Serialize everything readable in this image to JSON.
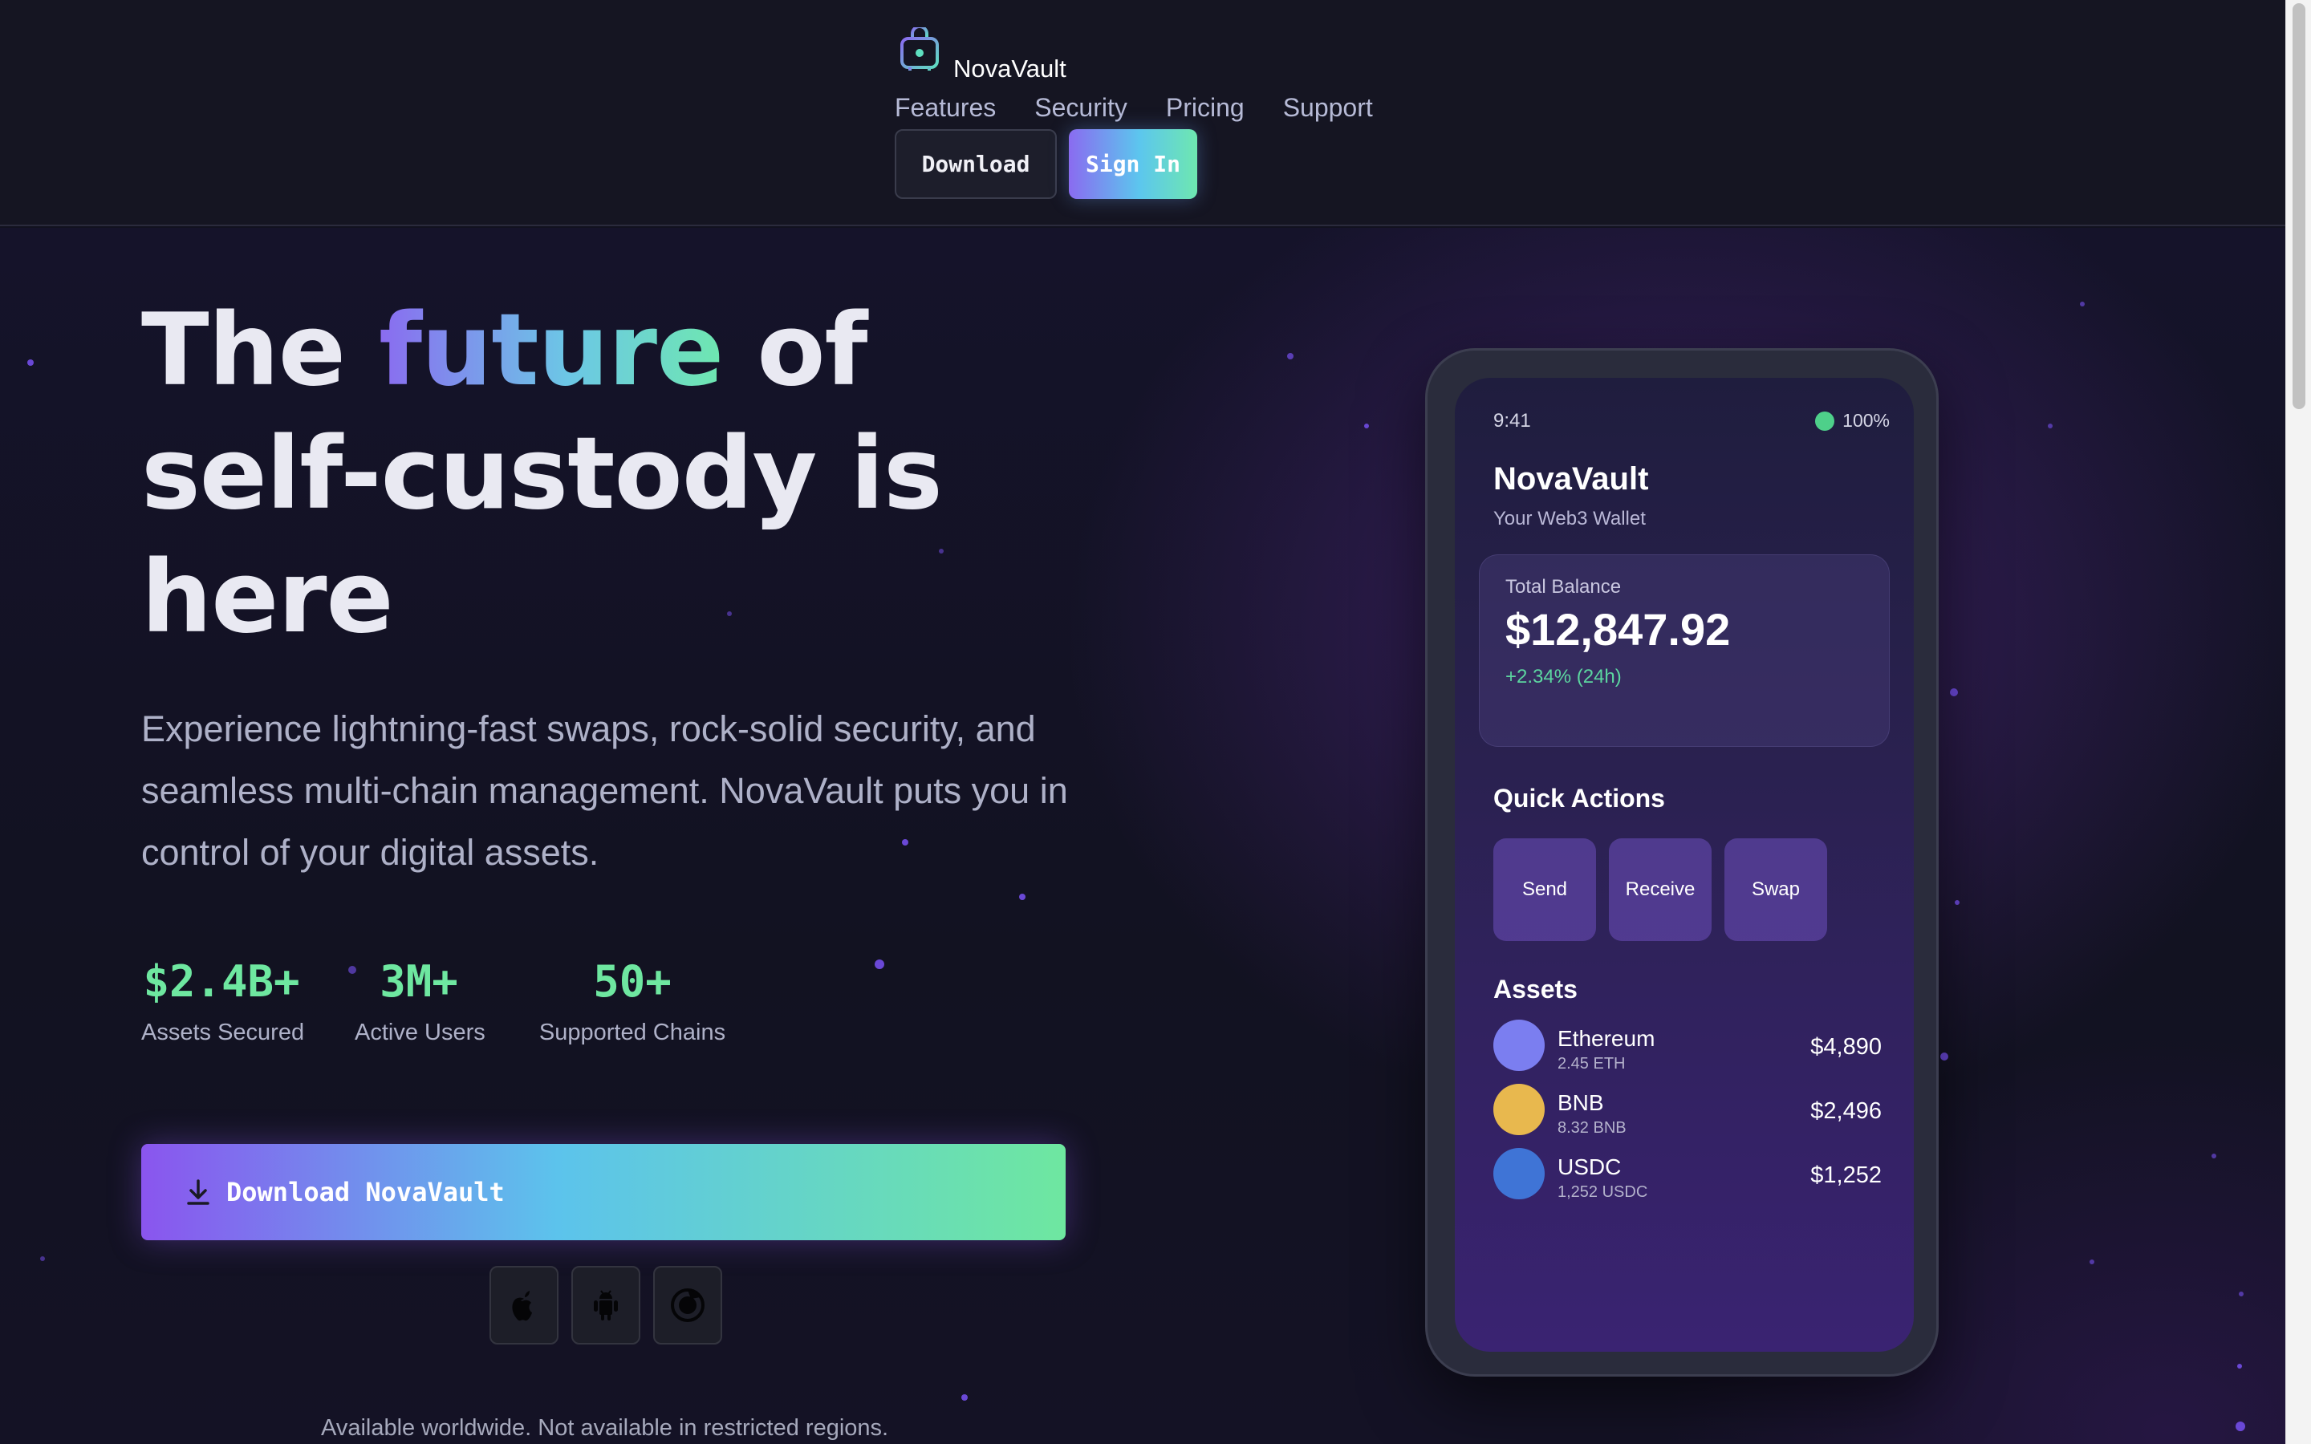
{
  "header": {
    "brand": "NovaVault",
    "nav": [
      "Features",
      "Security",
      "Pricing",
      "Support"
    ],
    "download_label": "Download",
    "signin_label": "Sign In"
  },
  "hero": {
    "headline_pre": "The ",
    "headline_accent": "future",
    "headline_post": " of self-custody is here",
    "subtext": "Experience lightning-fast swaps, rock-solid security, and seamless multi-chain management. NovaVault puts you in control of your digital assets.",
    "stats": [
      {
        "value": "$2.4B+",
        "label": "Assets Secured"
      },
      {
        "value": "3M+",
        "label": "Active Users"
      },
      {
        "value": "50+",
        "label": "Supported Chains"
      }
    ],
    "cta_label": "Download NovaVault",
    "platform_icons": [
      "apple-icon",
      "android-icon",
      "web-icon"
    ],
    "availability": "Available worldwide. Not available in restricted regions."
  },
  "phone": {
    "time": "9:41",
    "battery": "100%",
    "app_title": "NovaVault",
    "app_subtitle": "Your Web3 Wallet",
    "balance_label": "Total Balance",
    "balance_value": "$12,847.92",
    "balance_change": "+2.34% (24h)",
    "quick_actions_title": "Quick Actions",
    "quick_actions": [
      "Send",
      "Receive",
      "Swap"
    ],
    "assets_title": "Assets",
    "assets": [
      {
        "name": "Ethereum",
        "amount": "2.45 ETH",
        "value": "$4,890",
        "color": "#7b7ef0"
      },
      {
        "name": "BNB",
        "amount": "8.32 BNB",
        "value": "$2,496",
        "color": "#e8b84e"
      },
      {
        "name": "USDC",
        "amount": "1,252 USDC",
        "value": "$1,252",
        "color": "#3f74d6"
      }
    ]
  },
  "colors": {
    "accent_green": "#6ee7a0",
    "accent_purple": "#8a55ee",
    "accent_cyan": "#5cc3ec",
    "background": "#12121f"
  }
}
